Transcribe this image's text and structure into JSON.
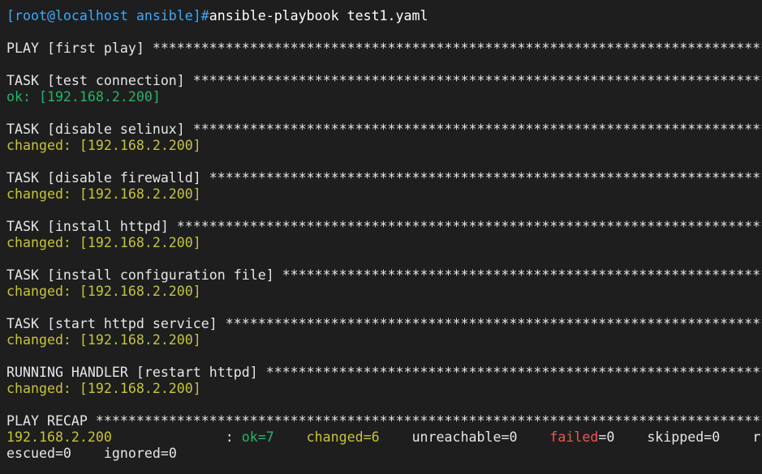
{
  "terminal": {
    "prompt": "[root@localhost ansible]#",
    "command": "ansible-playbook test1.yaml",
    "play_header": "PLAY [first play] ",
    "tasks": [
      {
        "header": "TASK [test connection] ",
        "status": "ok: [192.168.2.200]",
        "kind": "ok"
      },
      {
        "header": "TASK [disable selinux] ",
        "status": "changed: [192.168.2.200]",
        "kind": "changed"
      },
      {
        "header": "TASK [disable firewalld] ",
        "status": "changed: [192.168.2.200]",
        "kind": "changed"
      },
      {
        "header": "TASK [install httpd] ",
        "status": "changed: [192.168.2.200]",
        "kind": "changed"
      },
      {
        "header": "TASK [install configuration file] ",
        "status": "changed: [192.168.2.200]",
        "kind": "changed"
      },
      {
        "header": "TASK [start httpd service] ",
        "status": "changed: [192.168.2.200]",
        "kind": "changed"
      },
      {
        "header": "RUNNING HANDLER [restart httpd] ",
        "status": "changed: [192.168.2.200]",
        "kind": "changed"
      }
    ],
    "recap_header": "PLAY RECAP ",
    "recap": {
      "host": "192.168.2.200",
      "sep": "              : ",
      "ok": "ok=7",
      "changed": "changed=6",
      "unreachable": "unreachable=0",
      "failed": "failed",
      "failed_value": "=0",
      "skipped": "skipped=0",
      "rescued_head": "r",
      "rescued_tail": "escued=0",
      "ignored": "ignored=0"
    },
    "colors": {
      "background": "#1e1e1e",
      "prompt": "#3fa9f5",
      "ok": "#27b469",
      "changed": "#c6c43b",
      "failed": "#e8584f",
      "text": "#e6e6e6"
    }
  }
}
